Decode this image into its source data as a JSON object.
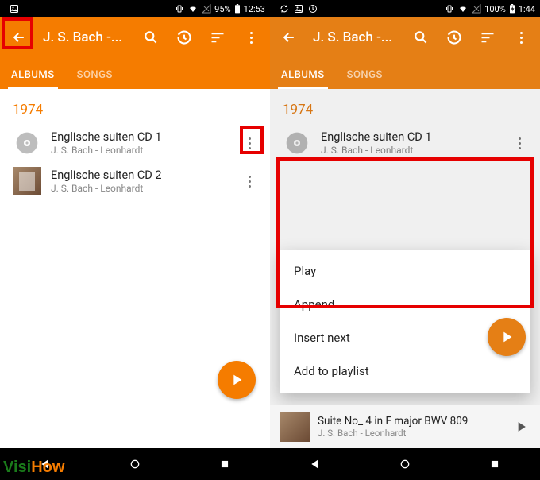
{
  "colors": {
    "accent": "#f57c00"
  },
  "watermark": {
    "visi": "Visi",
    "how": "How"
  },
  "statusbar": {
    "left": {
      "battery": "95%",
      "time": "12:53"
    },
    "right": {
      "battery": "100%",
      "time": "1:44"
    }
  },
  "toolbar": {
    "title": "J. S. Bach -..."
  },
  "tabs": {
    "albums": "ALBUMS",
    "songs": "SONGS"
  },
  "year": "1974",
  "albums": [
    {
      "title": "Englische suiten CD 1",
      "artist": "J. S. Bach - Leonhardt"
    },
    {
      "title": "Englische suiten CD 2",
      "artist": "J. S. Bach - Leonhardt"
    }
  ],
  "context_menu": {
    "play": "Play",
    "append": "Append",
    "insert": "Insert next",
    "add": "Add to playlist"
  },
  "nowplaying": {
    "title": "Suite No_ 4 in F major BWV 809",
    "artist": "J. S. Bach - Leonhardt"
  }
}
